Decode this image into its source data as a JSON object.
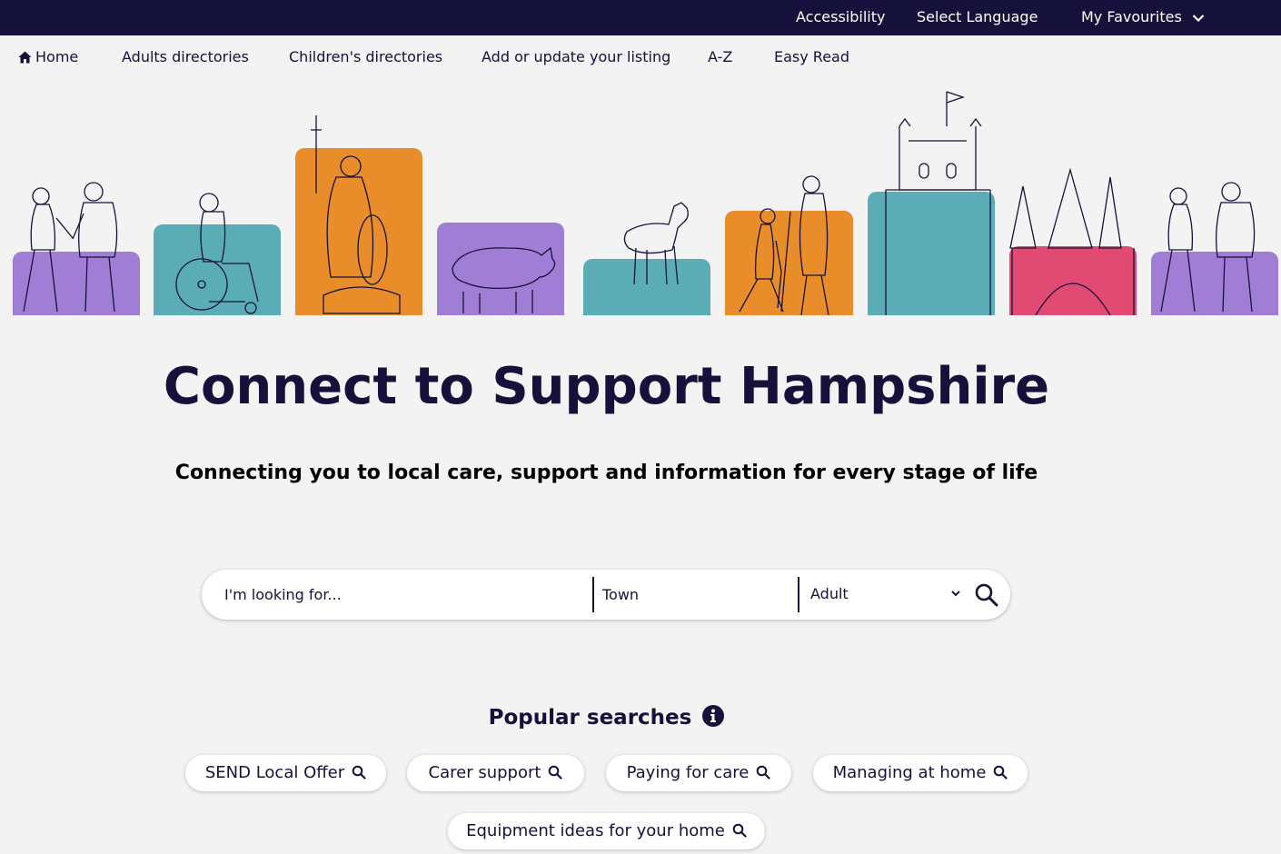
{
  "topbar": {
    "accessibility": "Accessibility",
    "select_language": "Select Language",
    "my_favourites": "My Favourites"
  },
  "nav": {
    "home": "Home",
    "adults": "Adults directories",
    "children": "Children's directories",
    "add_listing": "Add or update your listing",
    "az": "A-Z",
    "easy_read": "Easy Read"
  },
  "hero": {
    "tiles": [
      {
        "color": "#a07ed6",
        "subject": "couple-holding-hands"
      },
      {
        "color": "#5aadb5",
        "subject": "wheelchair-user"
      },
      {
        "color": "#e98c2a",
        "subject": "king-alfred-statue"
      },
      {
        "color": "#a07ed6",
        "subject": "pig"
      },
      {
        "color": "#5aadb5",
        "subject": "new-forest-pony"
      },
      {
        "color": "#e98c2a",
        "subject": "walkers-with-stick"
      },
      {
        "color": "#5aadb5",
        "subject": "castle-tower"
      },
      {
        "color": "#e04a73",
        "subject": "cathedral"
      },
      {
        "color": "#a07ed6",
        "subject": "couple-holding-hands"
      }
    ]
  },
  "main": {
    "title": "Connect to Support Hampshire",
    "subtitle": "Connecting you to local care, support and information for every stage of life"
  },
  "search": {
    "query_placeholder": "I'm looking for...",
    "town_placeholder": "Town",
    "audience_selected": "Adult"
  },
  "popular": {
    "heading": "Popular searches",
    "chips": [
      "SEND Local Offer",
      "Carer support",
      "Paying for care",
      "Managing at home",
      "Equipment ideas for your home"
    ]
  },
  "colors": {
    "navy": "#16113a",
    "purple": "#a07ed6",
    "teal": "#5aadb5",
    "orange": "#e98c2a",
    "pink": "#e04a73"
  }
}
